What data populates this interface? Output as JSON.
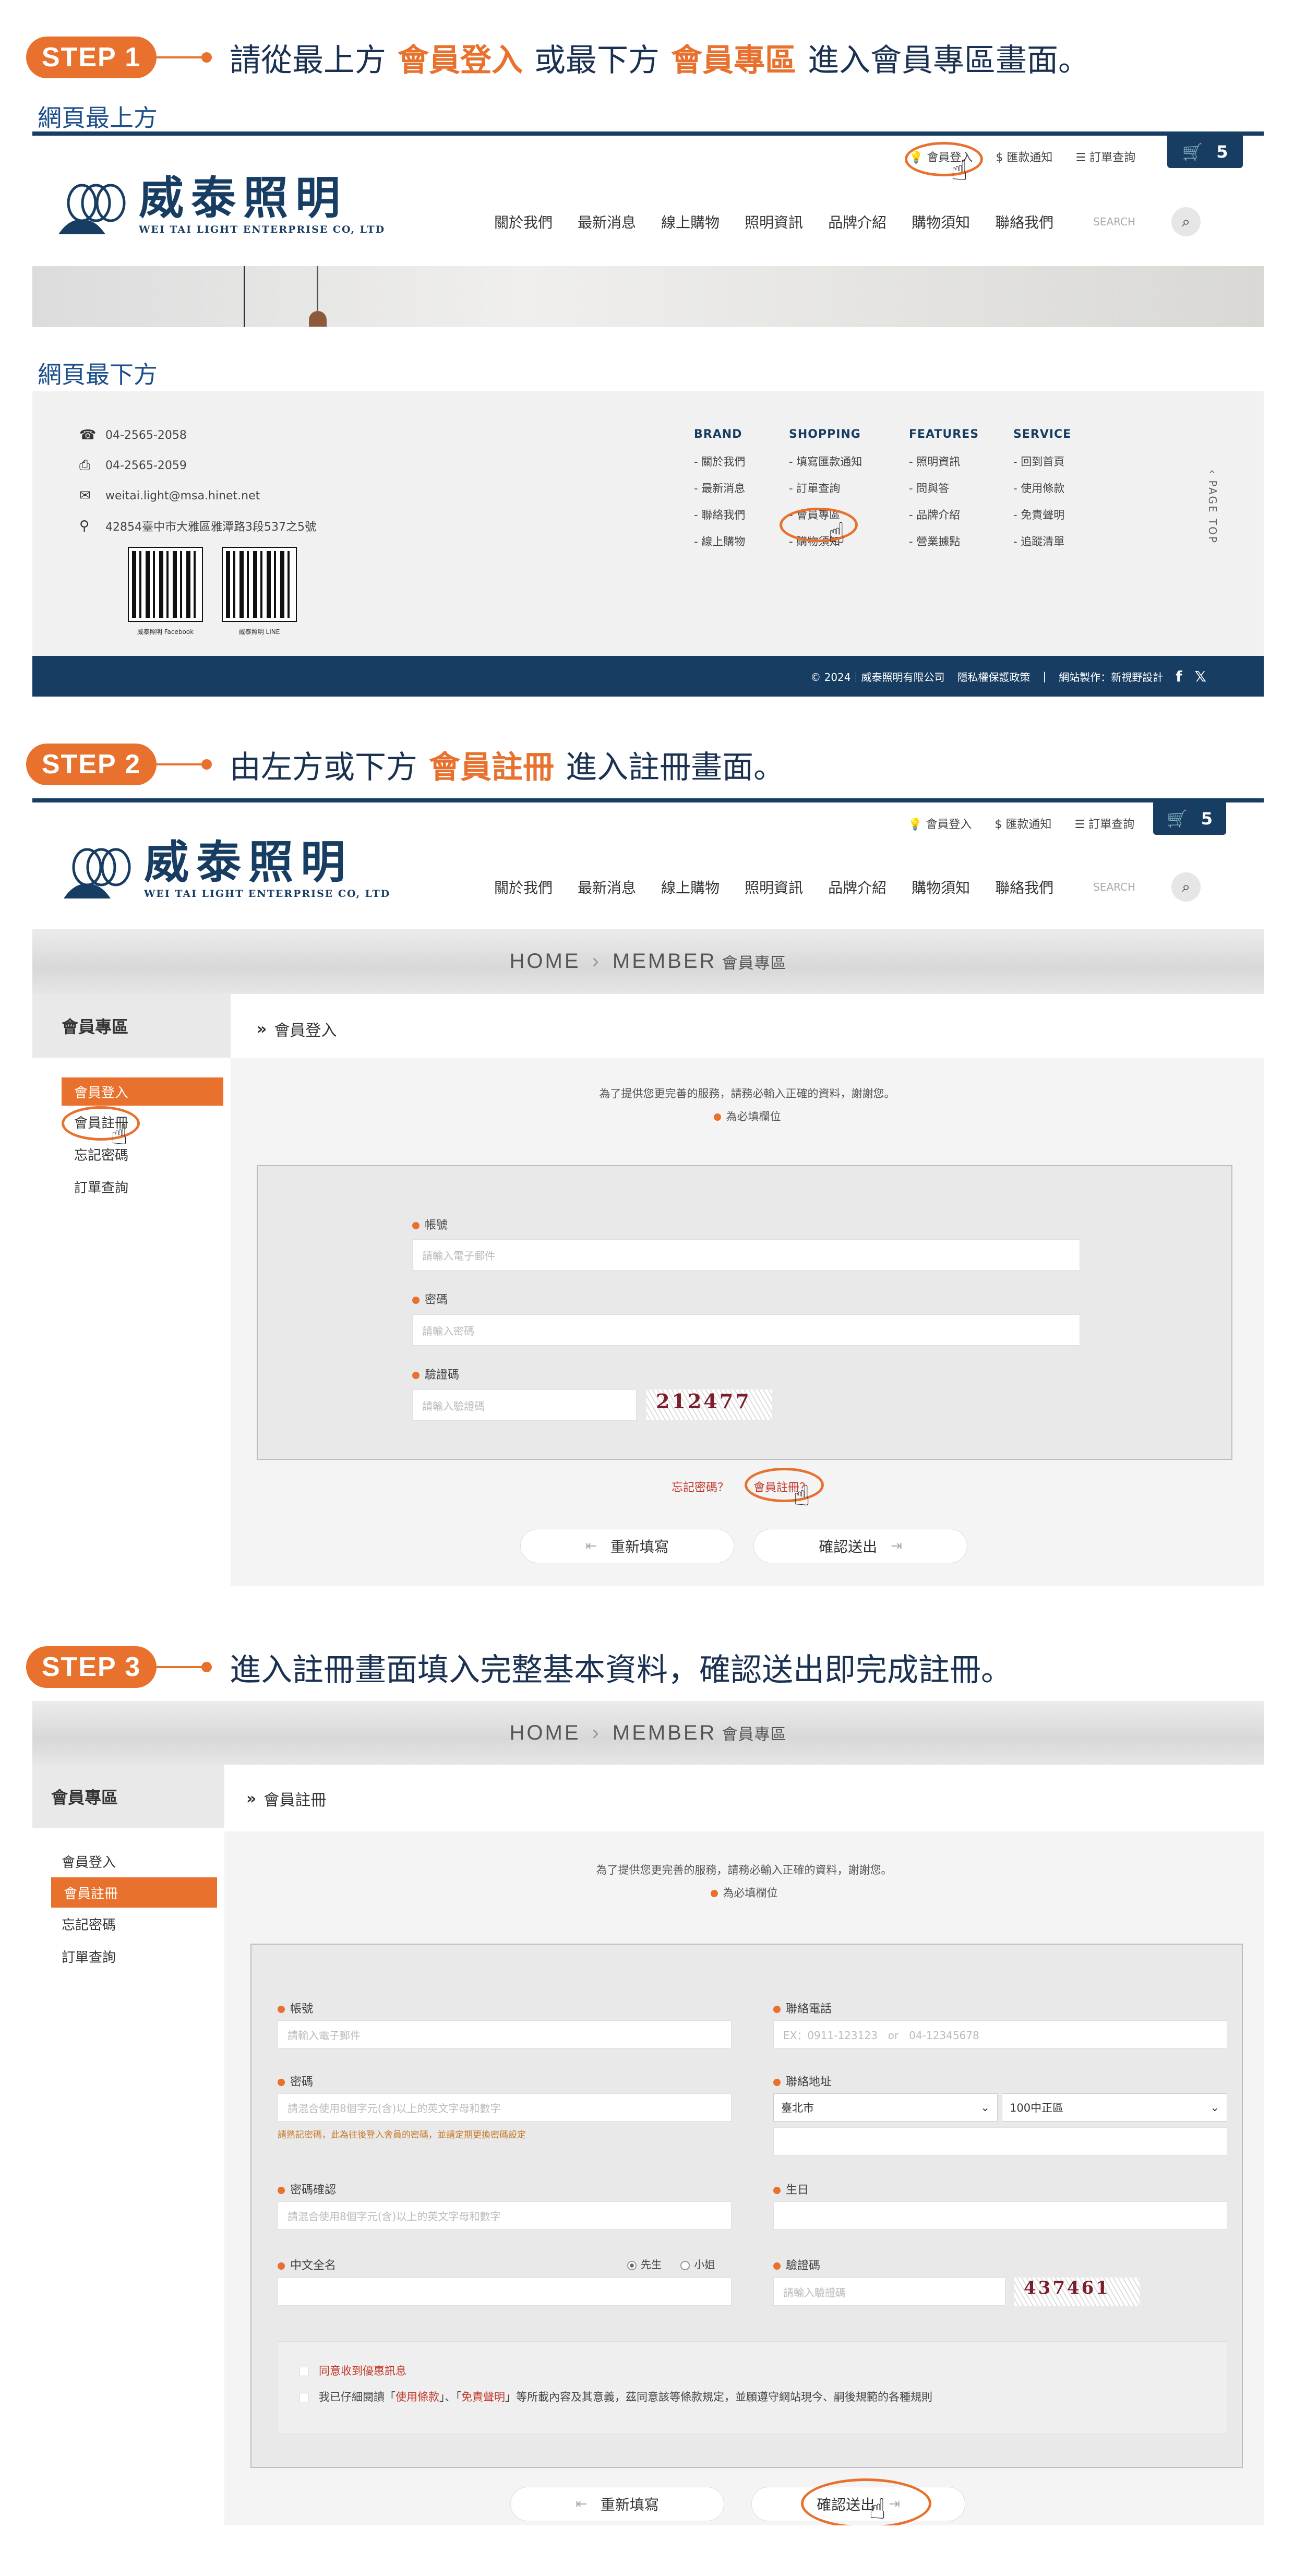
{
  "colors": {
    "accent": "#e8712e",
    "brand": "#173d63"
  },
  "step1": {
    "badge": "STEP 1",
    "text_pre": "請從最上方",
    "hl1": "會員登入",
    "text_mid": "或最下方",
    "hl2": "會員專區",
    "text_post": "進入會員專區畫面。",
    "caption_top": "網頁最上方",
    "caption_bottom": "網頁最下方"
  },
  "step2": {
    "badge": "STEP 2",
    "text_pre": "由左方或下方",
    "hl1": "會員註冊",
    "text_post": "進入註冊畫面。"
  },
  "step3": {
    "badge": "STEP 3",
    "text": "進入註冊畫面填入完整基本資料，確認送出即完成註冊。"
  },
  "header": {
    "top_links": [
      {
        "label": "會員登入",
        "icon": "bulb-icon"
      },
      {
        "label": "匯款通知",
        "icon": "dollar-icon"
      },
      {
        "label": "訂單查詢",
        "icon": "list-icon"
      }
    ],
    "cart_count": "5",
    "logo_cn": "威泰照明",
    "logo_en": "WEI TAI LIGHT ENTERPRISE CO, LTD",
    "nav": [
      "關於我們",
      "最新消息",
      "線上購物",
      "照明資訊",
      "品牌介紹",
      "購物須知",
      "聯絡我們"
    ],
    "search_placeholder": "SEARCH"
  },
  "footer": {
    "phone": "04-2565-2058",
    "fax": "04-2565-2059",
    "email": "weitai.light@msa.hinet.net",
    "address": "42854臺中市大雅區雅潭路3段537之5號",
    "qr_facebook": "威泰照明 Facebook",
    "qr_line": "威泰照明 LINE",
    "columns": [
      {
        "title": "BRAND",
        "items": [
          "關於我們",
          "最新消息",
          "聯絡我們",
          "線上購物"
        ]
      },
      {
        "title": "SHOPPING",
        "items": [
          "填寫匯款通知",
          "訂單查詢",
          "會員專區",
          "購物須知"
        ]
      },
      {
        "title": "FEATURES",
        "items": [
          "照明資訊",
          "問與答",
          "品牌介紹",
          "營業據點"
        ]
      },
      {
        "title": "SERVICE",
        "items": [
          "回到首頁",
          "使用條款",
          "免責聲明",
          "追蹤清單"
        ]
      }
    ],
    "page_top": "PAGE TOP",
    "copyright": "© 2024｜威泰照明有限公司",
    "privacy": "隱私權保護政策",
    "credit": "網站製作：新視野設計"
  },
  "member": {
    "banner_home": "HOME",
    "banner_sep": "›",
    "banner_member": "MEMBER",
    "banner_cn": "會員專區",
    "side_title": "會員專區",
    "side_items": [
      "會員登入",
      "會員註冊",
      "忘記密碼",
      "訂單查詢"
    ],
    "notice": "為了提供您更完善的服務，請務必輸入正確的資料，謝謝您。",
    "required": "為必填欄位"
  },
  "login": {
    "crumb": "會員登入",
    "account_label": "帳號",
    "account_ph": "請輸入電子郵件",
    "password_label": "密碼",
    "password_ph": "請輸入密碼",
    "captcha_label": "驗證碼",
    "captcha_ph": "請輸入驗證碼",
    "captcha": "212477",
    "forgot": "忘記密碼？",
    "register": "會員註冊？",
    "reset": "重新填寫",
    "submit": "確認送出"
  },
  "register": {
    "crumb": "會員註冊",
    "account_label": "帳號",
    "account_ph": "請輸入電子郵件",
    "phone_label": "聯絡電話",
    "phone_ph": "EX：0911-123123　or　04-12345678",
    "password_label": "密碼",
    "password_ph": "請混合使用8個字元(含)以上的英文字母和數字",
    "password_hint": "請熟記密碼，此為往後登入會員的密碼，並請定期更換密碼設定",
    "address_label": "聯絡地址",
    "city": "臺北市",
    "district": "100中正區",
    "confirm_label": "密碼確認",
    "confirm_ph": "請混合使用8個字元(含)以上的英文字母和數字",
    "birthday_label": "生日",
    "name_label": "中文全名",
    "gender_male": "先生",
    "gender_female": "小姐",
    "captcha_label": "驗證碼",
    "captcha_ph": "請輸入驗證碼",
    "captcha": "437461",
    "agree_promo": "同意收到優惠訊息",
    "agree_terms_pre": "我已仔細閱讀「",
    "terms": "使用條款",
    "agree_terms_mid": "」、「",
    "disclaimer": "免責聲明",
    "agree_terms_post": "」等所載內容及其意義，茲同意該等條款規定，並願遵守網站現今、嗣後規範的各種規則",
    "reset": "重新填寫",
    "submit": "確認送出"
  }
}
